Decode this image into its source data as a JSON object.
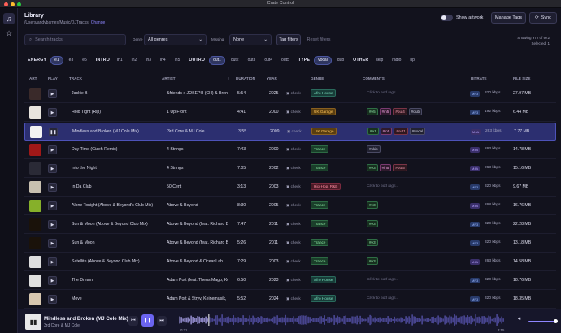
{
  "window": {
    "title": "Crate Control"
  },
  "header": {
    "title": "Library",
    "path": "/Users/andybarnes/Music/DJTracks",
    "change_label": "Change",
    "show_artwork_label": "Show artwork",
    "manage_tags_label": "Manage Tags",
    "sync_label": "Sync"
  },
  "filters": {
    "search_placeholder": "Search tracks",
    "genre_label": "Genre",
    "genre_value": "All genres",
    "missing_label": "Missing",
    "missing_value": "None",
    "tag_filters_label": "Tag filters",
    "reset_filters_label": "Reset filters",
    "showing": "Showing 972 of 972",
    "selected": "Selected: 1"
  },
  "chip_groups": [
    {
      "name": "ENERGY",
      "chips": [
        {
          "label": "e1",
          "active": true
        },
        {
          "label": "e3",
          "active": false
        },
        {
          "label": "e5",
          "active": false
        }
      ]
    },
    {
      "name": "INTRO",
      "chips": [
        {
          "label": "in1",
          "active": false
        },
        {
          "label": "in2",
          "active": false
        },
        {
          "label": "in3",
          "active": false
        },
        {
          "label": "in4",
          "active": false
        },
        {
          "label": "in5",
          "active": false
        }
      ]
    },
    {
      "name": "OUTRO",
      "chips": [
        {
          "label": "out1",
          "active": true
        },
        {
          "label": "out2",
          "active": false
        },
        {
          "label": "out3",
          "active": false
        },
        {
          "label": "out4",
          "active": false
        },
        {
          "label": "out5",
          "active": false
        }
      ]
    },
    {
      "name": "TYPE",
      "chips": [
        {
          "label": "vocal",
          "active": true
        },
        {
          "label": "dub",
          "active": false
        }
      ]
    },
    {
      "name": "OTHER",
      "chips": [
        {
          "label": "skip",
          "active": false
        },
        {
          "label": "radio",
          "active": false
        },
        {
          "label": "rip",
          "active": false
        }
      ]
    }
  ],
  "columns": {
    "art": "ART",
    "play": "PLAY",
    "track": "TRACK",
    "artist": "ARTIST",
    "sort_arrow": "↑",
    "duration": "DURATION",
    "year": "YEAR",
    "genre": "GENRE",
    "comments": "COMMENTS",
    "bitrate": "BITRATE",
    "filesize": "FILE SIZE"
  },
  "check_label": "check",
  "comment_placeholder": "Click to add tags...",
  "tracks": [
    {
      "track": "Jackie B",
      "artist": "&friends x JOSEPH (CH) & Brent",
      "duration": "5:54",
      "year": "2025",
      "genre": "Afro House",
      "gclass": "g-afro",
      "tags": [],
      "format": "MP3",
      "bitrate": "320 kbps",
      "size": "27.97 MB",
      "art": "#3a2a2a",
      "selected": false
    },
    {
      "track": "Hold Tight (Rip)",
      "artist": "1 Up Front",
      "duration": "4:41",
      "year": "2000",
      "genre": "UK Garage",
      "gclass": "g-ukg",
      "tags": [
        "#e5",
        "#in5",
        "#out4",
        "#dub"
      ],
      "format": "MP3",
      "bitrate": "192 kbps",
      "size": "6.44 MB",
      "art": "#e8e4de",
      "selected": false
    },
    {
      "track": "Mindless and Broken (MJ Cole Mix)",
      "artist": "3rd Core & MJ Cole",
      "duration": "3:55",
      "year": "2009",
      "genre": "UK Garage",
      "gclass": "g-ukg",
      "tags": [
        "#e1",
        "#in5",
        "#out1",
        "#vocal"
      ],
      "format": "M4A",
      "bitrate": "263 kbps",
      "size": "7.77 MB",
      "art": "#f2f2f2",
      "selected": true
    },
    {
      "track": "Day Time (Gizeh Remix)",
      "artist": "4 Strings",
      "duration": "7:43",
      "year": "2000",
      "genre": "Trance",
      "gclass": "g-tr",
      "tags": [
        "#skip"
      ],
      "format": "M4A",
      "bitrate": "263 kbps",
      "size": "14.78 MB",
      "art": "#a01818",
      "selected": false
    },
    {
      "track": "Into the Night",
      "artist": "4 Strings",
      "duration": "7:05",
      "year": "2002",
      "genre": "Trance",
      "gclass": "g-tr",
      "tags": [
        "#e3",
        "#in5",
        "#out5"
      ],
      "format": "M4A",
      "bitrate": "263 kbps",
      "size": "15.16 MB",
      "art": "#2a2a36",
      "selected": false
    },
    {
      "track": "In Da Club",
      "artist": "50 Cent",
      "duration": "3:13",
      "year": "2003",
      "genre": "Hip-Hop, R&B",
      "gclass": "g-hip",
      "tags": [],
      "format": "MP3",
      "bitrate": "320 kbps",
      "size": "9.67 MB",
      "art": "#c8c0b0",
      "selected": false
    },
    {
      "track": "Alone Tonight (Above & Beyond's Club Mix)",
      "artist": "Above & Beyond",
      "duration": "8:30",
      "year": "2005",
      "genre": "Trance",
      "gclass": "g-tr",
      "tags": [
        "#e3"
      ],
      "format": "M4A",
      "bitrate": "268 kbps",
      "size": "16.76 MB",
      "art": "#86b02a",
      "selected": false
    },
    {
      "track": "Sun & Moon (Above & Beyond Club Mix)",
      "artist": "Above & Beyond (feat. Richard B",
      "duration": "7:47",
      "year": "2011",
      "genre": "Trance",
      "gclass": "g-tr",
      "tags": [
        "#e3"
      ],
      "format": "MP3",
      "bitrate": "320 kbps",
      "size": "22.28 MB",
      "art": "#1a120a",
      "selected": false
    },
    {
      "track": "Sun & Moon",
      "artist": "Above & Beyond (feat. Richard B",
      "duration": "5:26",
      "year": "2011",
      "genre": "Trance",
      "gclass": "g-tr",
      "tags": [
        "#e3"
      ],
      "format": "MP3",
      "bitrate": "320 kbps",
      "size": "13.18 MB",
      "art": "#1a120a",
      "selected": false
    },
    {
      "track": "Satellite (Above & Beyond Club Mix)",
      "artist": "Above & Beyond & OceanLab",
      "duration": "7:29",
      "year": "2003",
      "genre": "Trance",
      "gclass": "g-tr",
      "tags": [
        "#e3"
      ],
      "format": "M4A",
      "bitrate": "263 kbps",
      "size": "14.58 MB",
      "art": "#dedede",
      "selected": false
    },
    {
      "track": "The Dream",
      "artist": "Adam Port (feat. Theus Mago, Ke",
      "duration": "6:50",
      "year": "2023",
      "genre": "Afro House",
      "gclass": "g-afro",
      "tags": [],
      "format": "MP3",
      "bitrate": "320 kbps",
      "size": "18.76 MB",
      "art": "#e0e0e0",
      "selected": false
    },
    {
      "track": "Move",
      "artist": "Adam Port & Stryv, Keinemusik, (",
      "duration": "5:52",
      "year": "2024",
      "genre": "Afro House",
      "gclass": "g-afro",
      "tags": [],
      "format": "MP3",
      "bitrate": "320 kbps",
      "size": "18.35 MB",
      "art": "#d8c8b0",
      "selected": false
    }
  ],
  "player": {
    "title": "Mindless and Broken (MJ Cole Mix)",
    "artist": "3rd Core & MJ Cole",
    "elapsed": "0:21",
    "total": "3:55",
    "progress": 0.09,
    "volume": 1.0,
    "accent": "#6b64f0"
  }
}
